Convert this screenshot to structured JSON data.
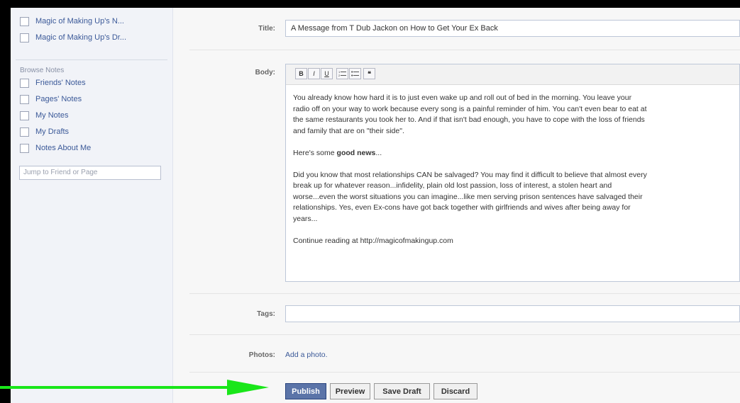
{
  "sidebar": {
    "top_items": [
      {
        "label": "Magic of Making Up's N..."
      },
      {
        "label": "Magic of Making Up's Dr..."
      }
    ],
    "browse_heading": "Browse Notes",
    "browse_items": [
      {
        "label": "Friends' Notes"
      },
      {
        "label": "Pages' Notes"
      },
      {
        "label": "My Notes"
      },
      {
        "label": "My Drafts"
      },
      {
        "label": "Notes About Me"
      }
    ],
    "jump_placeholder": "Jump to Friend or Page"
  },
  "form": {
    "title_label": "Title:",
    "title_value": "A Message from T Dub Jackon on How to Get Your Ex Back",
    "body_label": "Body:",
    "toolbar": [
      "B",
      "I",
      "U",
      "ol",
      "ul",
      "quote"
    ],
    "toolbar_icons": [
      "bold-icon",
      "italic-icon",
      "underline-icon",
      "numbered-list-icon",
      "bulleted-list-icon",
      "quote-icon"
    ],
    "body": {
      "p1": [
        "You already know how hard it is to just even wake up and roll out of bed in the morning. You leave your",
        "radio off on your way to work because every song is a painful reminder of him. You can't even bear to eat at",
        "the same restaurants you took her to.  And if that isn't bad enough, you have to cope with the loss of friends",
        "and family that are on \"their side\"."
      ],
      "p2_prefix": "Here's some ",
      "p2_bold": "good news",
      "p2_suffix": "...",
      "p3": [
        "Did you know that most relationships CAN be salvaged? You may find it difficult to believe that almost every",
        "break up for whatever reason...infidelity, plain old lost passion, loss of interest, a stolen heart and",
        "worse...even the worst situations you can imagine...like men serving prison sentences have salvaged their",
        "relationships. Yes, even Ex-cons have got back together with girlfriends and wives after being away for",
        "years..."
      ],
      "p4": "Continue reading at http://magicofmakingup.com"
    },
    "tags_label": "Tags:",
    "tags_value": "",
    "photos_label": "Photos:",
    "add_photo": "Add a photo."
  },
  "actions": {
    "publish": "Publish",
    "preview": "Preview",
    "save_draft": "Save Draft",
    "discard": "Discard"
  },
  "colors": {
    "link": "#3b5998",
    "publish_bg": "#5b74a8",
    "arrow": "#19e619",
    "frame": "#000000"
  }
}
